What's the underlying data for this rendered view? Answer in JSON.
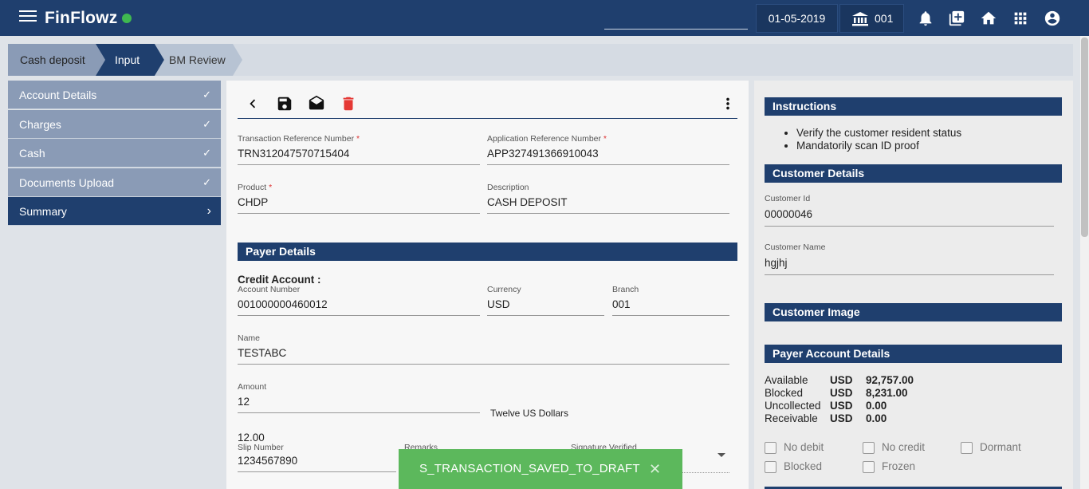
{
  "header": {
    "app_name": "FinFlowz",
    "date": "01-05-2019",
    "branch": "001",
    "icons": [
      "menu-icon",
      "bell-icon",
      "add-box-icon",
      "home-icon",
      "apps-grid-icon",
      "account-circle-icon"
    ],
    "status_color": "#3fb950"
  },
  "breadcrumb": {
    "steps": [
      "Cash deposit",
      "Input",
      "BM Review"
    ]
  },
  "nav": {
    "items": [
      {
        "label": "Account Details",
        "mark": "✓"
      },
      {
        "label": "Charges",
        "mark": "✓"
      },
      {
        "label": "Cash",
        "mark": "✓"
      },
      {
        "label": "Documents Upload",
        "mark": "✓"
      },
      {
        "label": "Summary",
        "mark": "›"
      }
    ]
  },
  "form": {
    "txn_ref": {
      "label": "Transaction Reference Number",
      "value": "TRN312047570715404"
    },
    "app_ref": {
      "label": "Application Reference Number",
      "value": "APP327491366910043"
    },
    "product": {
      "label": "Product",
      "value": "CHDP"
    },
    "description": {
      "label": "Description",
      "value": "CASH DEPOSIT"
    },
    "payer_section": "Payer Details",
    "credit_account": "Credit Account :",
    "account_number": {
      "label": "Account Number",
      "value": "001000000460012"
    },
    "currency": {
      "label": "Currency",
      "value": "USD"
    },
    "branch": {
      "label": "Branch",
      "value": "001"
    },
    "name": {
      "label": "Name",
      "value": "TESTABC"
    },
    "amount": {
      "label": "Amount",
      "value": "12"
    },
    "amount_words": "Twelve US Dollars",
    "amount_formatted": "12.00",
    "slip": {
      "label": "Slip Number",
      "value": "1234567890"
    },
    "remarks": {
      "label": "Remarks"
    },
    "signature": {
      "label": "Signature Verified"
    },
    "required_mark": "*"
  },
  "right": {
    "instructions_title": "Instructions",
    "instructions": [
      "Verify the customer resident status",
      "Mandatorily scan ID proof"
    ],
    "customer_details_title": "Customer Details",
    "customer_id": {
      "label": "Customer Id",
      "value": "00000046"
    },
    "customer_name": {
      "label": "Customer Name",
      "value": "hgjhj"
    },
    "customer_image_title": "Customer Image",
    "payer_account_title": "Payer Account Details",
    "balances": [
      {
        "label": "Available",
        "ccy": "USD",
        "amount": "92,757.00"
      },
      {
        "label": "Blocked",
        "ccy": "USD",
        "amount": "8,231.00"
      },
      {
        "label": "Uncollected",
        "ccy": "USD",
        "amount": "0.00"
      },
      {
        "label": "Receivable",
        "ccy": "USD",
        "amount": "0.00"
      }
    ],
    "flags": [
      "No debit",
      "No credit",
      "Dormant",
      "Blocked",
      "Frozen"
    ]
  },
  "toast": {
    "message": "S_TRANSACTION_SAVED_TO_DRAFT",
    "close": "✕"
  }
}
